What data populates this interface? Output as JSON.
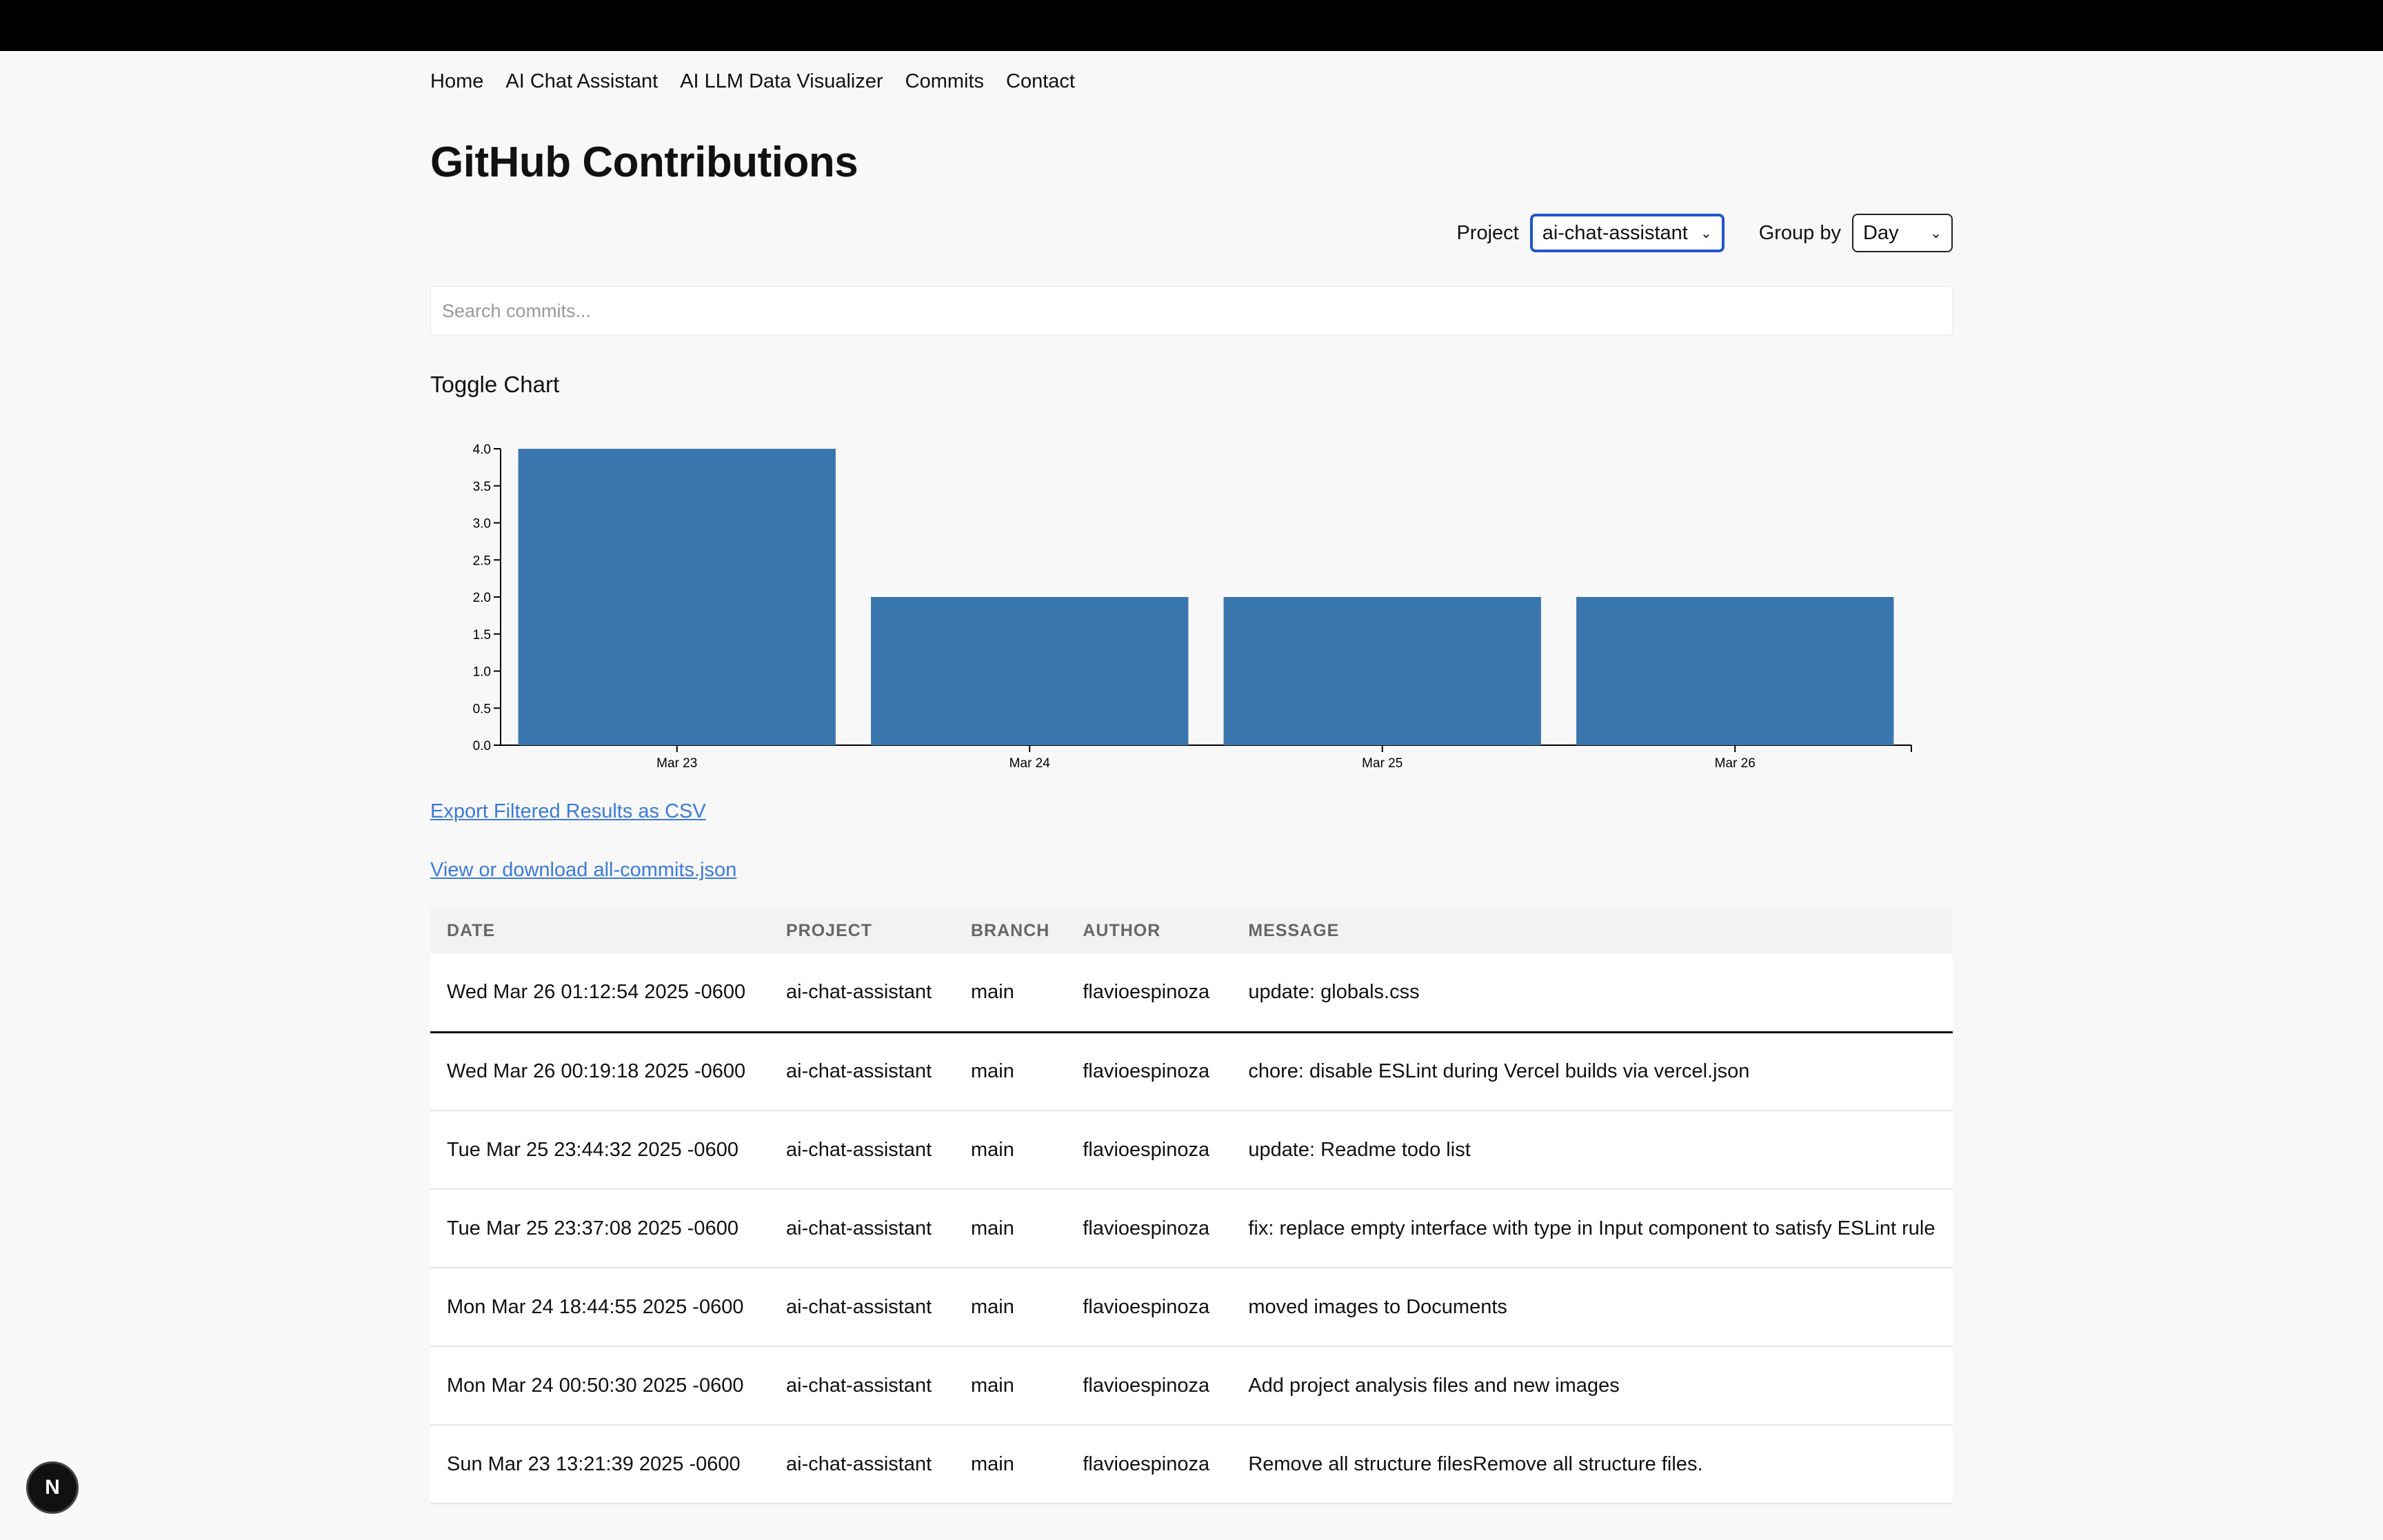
{
  "nav": {
    "items": [
      "Home",
      "AI Chat Assistant",
      "AI LLM Data Visualizer",
      "Commits",
      "Contact"
    ]
  },
  "page": {
    "title": "GitHub Contributions"
  },
  "filters": {
    "project_label": "Project",
    "project_value": "ai-chat-assistant",
    "group_label": "Group by",
    "group_value": "Day"
  },
  "search": {
    "placeholder": "Search commits..."
  },
  "toggle_label": "Toggle Chart",
  "chart_data": {
    "type": "bar",
    "categories": [
      "Mar 23",
      "Mar 24",
      "Mar 25",
      "Mar 26"
    ],
    "values": [
      4,
      2,
      2,
      2
    ],
    "ylim": [
      0,
      4
    ],
    "yticks": [
      "0.0",
      "0.5",
      "1.0",
      "1.5",
      "2.0",
      "2.5",
      "3.0",
      "3.5",
      "4.0"
    ],
    "color": "#3a76ae",
    "grid": false
  },
  "links": {
    "export_csv": "Export Filtered Results as CSV",
    "view_json": "View or download all-commits.json"
  },
  "table": {
    "headers": [
      "DATE",
      "PROJECT",
      "BRANCH",
      "AUTHOR",
      "MESSAGE"
    ],
    "rows": [
      [
        "Wed Mar 26 01:12:54 2025 -0600",
        "ai-chat-assistant",
        "main",
        "flavioespinoza",
        "update: globals.css"
      ],
      [
        "Wed Mar 26 00:19:18 2025 -0600",
        "ai-chat-assistant",
        "main",
        "flavioespinoza",
        "chore: disable ESLint during Vercel builds via vercel.json"
      ],
      [
        "Tue Mar 25 23:44:32 2025 -0600",
        "ai-chat-assistant",
        "main",
        "flavioespinoza",
        "update: Readme todo list"
      ],
      [
        "Tue Mar 25 23:37:08 2025 -0600",
        "ai-chat-assistant",
        "main",
        "flavioespinoza",
        "fix: replace empty interface with type in Input component to satisfy ESLint rule"
      ],
      [
        "Mon Mar 24 18:44:55 2025 -0600",
        "ai-chat-assistant",
        "main",
        "flavioespinoza",
        "moved images to Documents"
      ],
      [
        "Mon Mar 24 00:50:30 2025 -0600",
        "ai-chat-assistant",
        "main",
        "flavioespinoza",
        "Add project analysis files and new images"
      ],
      [
        "Sun Mar 23 13:21:39 2025 -0600",
        "ai-chat-assistant",
        "main",
        "flavioespinoza",
        "Remove all structure filesRemove all structure files."
      ]
    ]
  },
  "badge": {
    "letter": "N"
  }
}
